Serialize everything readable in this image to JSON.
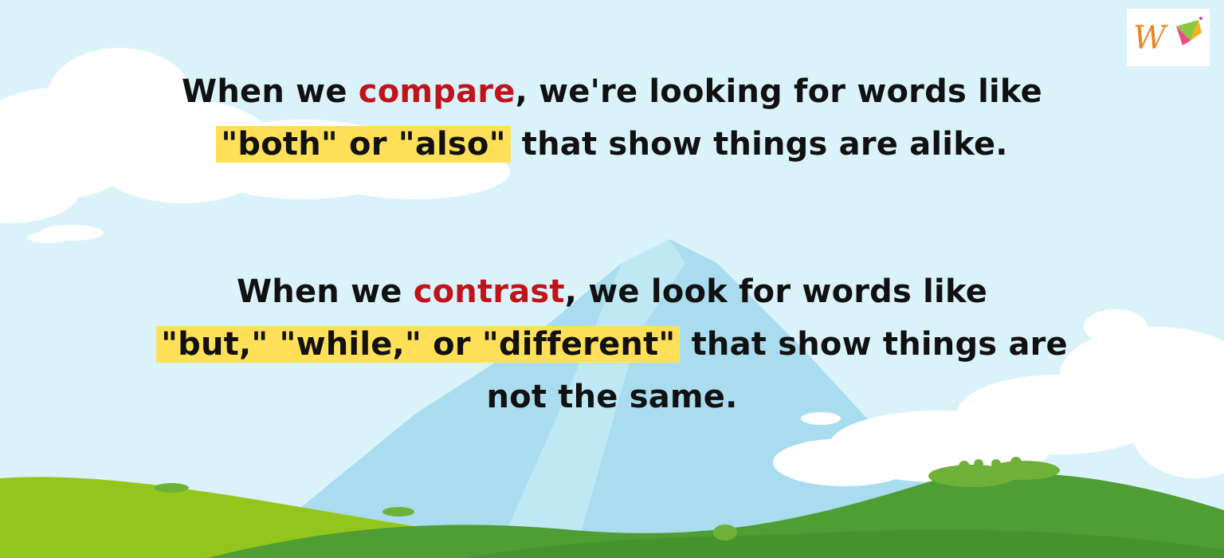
{
  "colors": {
    "sky": "#dff4fb",
    "cloud": "#ffffff",
    "mountain": "#a9d9ee",
    "grass_light": "#9ccb1f",
    "grass_dark": "#4f9e34",
    "highlight": "#ffe058",
    "keyword": "#c0141a",
    "text": "#111111"
  },
  "compare": {
    "l1_a": "When we ",
    "l1_kw": "compare",
    "l1_b": ", we're looking for words like",
    "l2_hl": "\"both\" or \"also\"",
    "l2_b": "that show things are alike."
  },
  "contrast": {
    "l1_a": "When we ",
    "l1_kw": "contrast",
    "l1_b": ", we look for words like",
    "l2_hl": "\"but,\" \"while,\" or \"different\"",
    "l2_b": "that show things are",
    "l3": "not the same."
  },
  "logo": {
    "icon": "w-letter-kite-logo"
  }
}
